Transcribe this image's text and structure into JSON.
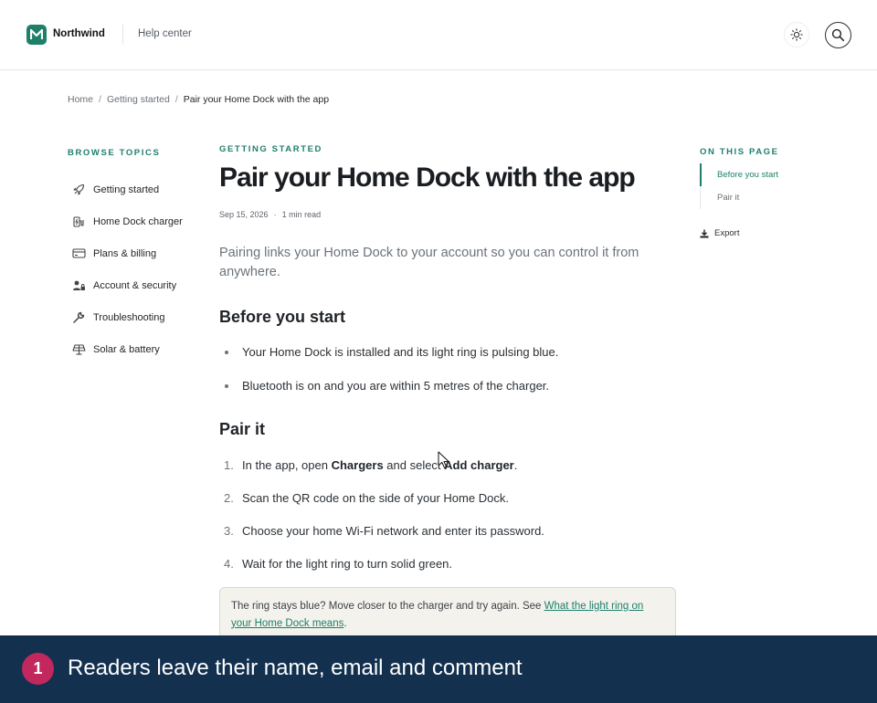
{
  "header": {
    "brand": "Northwind",
    "logo_letter": "M",
    "nav_label": "Help center",
    "icons": {
      "theme": "sun-icon",
      "search": "search-icon"
    }
  },
  "breadcrumb": [
    "Home",
    "Getting started",
    "Pair your Home Dock with the app"
  ],
  "sidebar": {
    "title": "BROWSE TOPICS",
    "items": [
      {
        "label": "Getting started",
        "icon": "rocket-icon"
      },
      {
        "label": "Home Dock charger",
        "icon": "charger-icon"
      },
      {
        "label": "Plans & billing",
        "icon": "card-icon"
      },
      {
        "label": "Account & security",
        "icon": "user-lock-icon"
      },
      {
        "label": "Troubleshooting",
        "icon": "wrench-icon"
      },
      {
        "label": "Solar & battery",
        "icon": "solar-panel-icon"
      }
    ]
  },
  "article": {
    "eyebrow": "GETTING STARTED",
    "title": "Pair your Home Dock with the app",
    "date": "Sep 15, 2026",
    "read_time": "1 min read",
    "lead": "Pairing links your Home Dock to your account so you can control it from anywhere.",
    "section1": {
      "heading": "Before you start",
      "bullets": [
        "Your Home Dock is installed and its light ring is pulsing blue.",
        "Bluetooth is on and you are within 5 metres of the charger."
      ]
    },
    "section2": {
      "heading": "Pair it",
      "steps": [
        {
          "num": "1.",
          "pre": "In the app, open ",
          "b1": "Chargers",
          "mid": " and select ",
          "b2": "Add charger",
          "post": "."
        },
        {
          "num": "2.",
          "text": "Scan the QR code on the side of your Home Dock."
        },
        {
          "num": "3.",
          "text": "Choose your home Wi-Fi network and enter its password."
        },
        {
          "num": "4.",
          "text": "Wait for the light ring to turn solid green."
        }
      ]
    },
    "note": {
      "text": "The ring stays blue? Move closer to the charger and try again. See ",
      "link": "What the light ring on your Home Dock means",
      "end": "."
    }
  },
  "toc": {
    "title": "ON THIS PAGE",
    "items": [
      "Before you start",
      "Pair it"
    ],
    "active_index": 0,
    "export_label": "Export"
  },
  "caption": {
    "badge": "1",
    "text": "Readers leave their name, email and comment"
  },
  "colors": {
    "accent": "#1e7f6b",
    "caption_bg": "#13304f",
    "badge": "#c2285d"
  }
}
